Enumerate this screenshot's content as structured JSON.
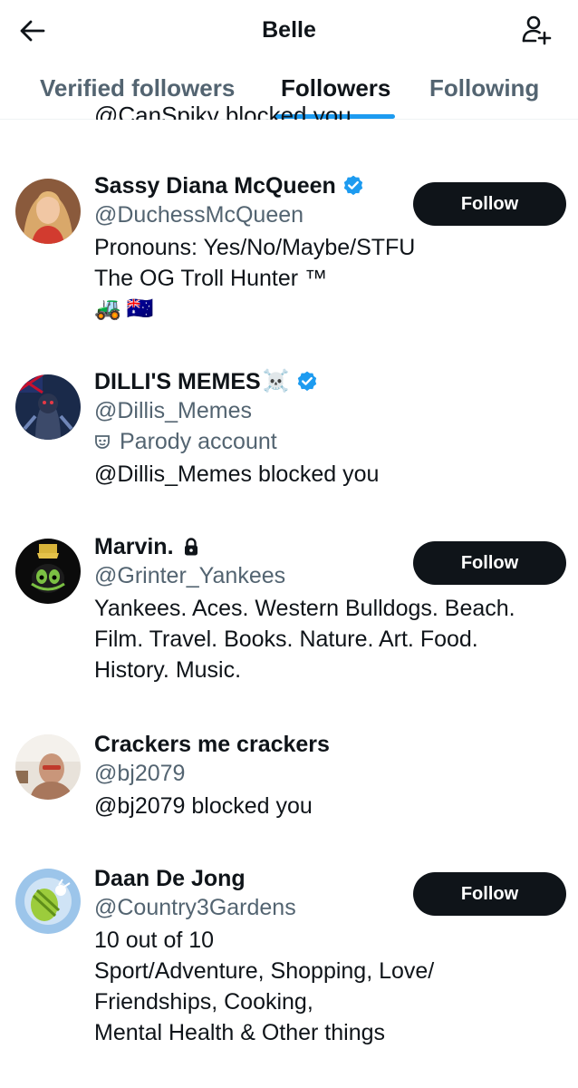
{
  "header": {
    "title": "Belle",
    "back_icon": "arrow-left-icon",
    "add_icon": "person-add-icon"
  },
  "tabs": [
    {
      "label": "Verified followers",
      "active": false
    },
    {
      "label": "Followers",
      "active": true
    },
    {
      "label": "Following",
      "active": false
    }
  ],
  "clipped_text": "@CanSpiky blocked you",
  "users": [
    {
      "name": "Sassy Diana McQueen",
      "handle": "@DuchessMcQueen",
      "verified": true,
      "bio": [
        "Pronouns: Yes/No/Maybe/STFU",
        "The OG Troll Hunter ™"
      ],
      "emojis": [
        "🚜",
        "🇦🇺"
      ],
      "follow_label": "Follow"
    },
    {
      "name": "DILLI'S MEMES",
      "name_emoji": "☠️",
      "handle": "@Dillis_Memes",
      "verified": true,
      "parody": "Parody account",
      "blocked": "@Dillis_Memes blocked you"
    },
    {
      "name": "Marvin.",
      "handle": "@Grinter_Yankees",
      "protected": true,
      "bio": [
        "Yankees. Aces. Western Bulldogs. Beach.",
        "Film. Travel. Books. Nature. Art. Food.",
        "History. Music."
      ],
      "follow_label": "Follow"
    },
    {
      "name": "Crackers me crackers",
      "handle": "@bj2079",
      "blocked": "@bj2079 blocked you"
    },
    {
      "name": "Daan De Jong",
      "handle": "@Country3Gardens",
      "bio": [
        "10 out of 10",
        "Sport/Adventure, Shopping, Love/",
        "Friendships, Cooking,",
        "Mental Health & Other things"
      ],
      "follow_label": "Follow"
    }
  ],
  "colors": {
    "accent": "#1d9bf0",
    "text": "#0f1419",
    "secondary": "#536471",
    "button_bg": "#0f1419"
  }
}
